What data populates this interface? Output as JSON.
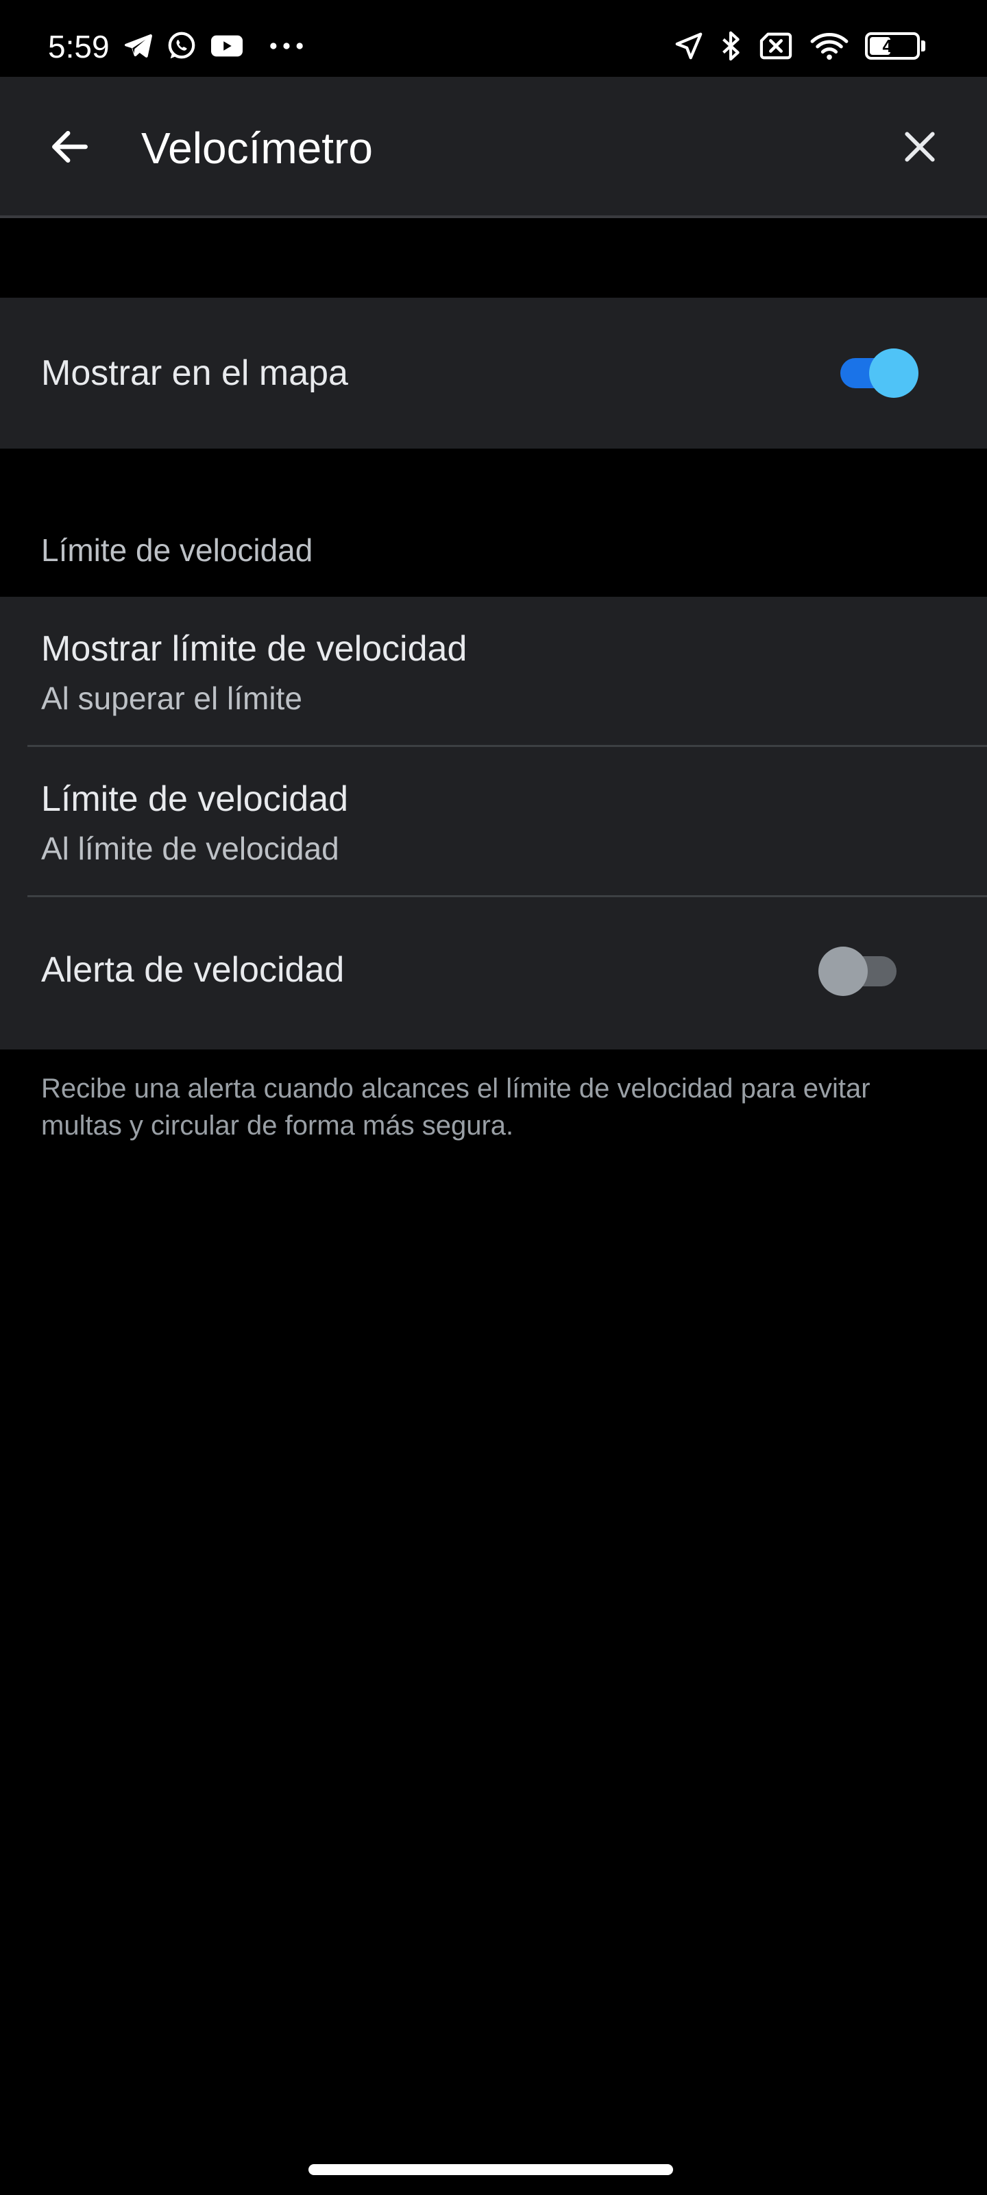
{
  "status_bar": {
    "time": "5:59",
    "left_icons": [
      "telegram-icon",
      "whatsapp-icon",
      "youtube-icon",
      "more-dots-icon"
    ],
    "right_icons": [
      "location-arrow-icon",
      "bluetooth-icon",
      "no-sim-icon",
      "wifi-icon",
      "battery-icon"
    ],
    "battery_level": "45",
    "battery_fraction": 0.45
  },
  "app_bar": {
    "title": "Velocímetro",
    "back_icon": "arrow-left-icon",
    "close_icon": "close-icon"
  },
  "show_on_map": {
    "label": "Mostrar en el mapa",
    "enabled": true
  },
  "speed_limit_section": {
    "header": "Límite de velocidad",
    "items": [
      {
        "title": "Mostrar límite de velocidad",
        "subtitle": "Al superar el límite"
      },
      {
        "title": "Límite de velocidad",
        "subtitle": "Al límite de velocidad"
      }
    ],
    "speed_alert": {
      "label": "Alerta de velocidad",
      "enabled": false
    },
    "footnote": "Recibe una alerta cuando alcances el límite de velocidad para evitar multas y circular de forma más segura."
  },
  "colors": {
    "background": "#000000",
    "surface": "#202124",
    "toggle_on_track": "#1a73e8",
    "toggle_on_thumb": "#4fc3f7",
    "toggle_off_track": "#5f6368",
    "toggle_off_thumb": "#9aa0a6"
  }
}
